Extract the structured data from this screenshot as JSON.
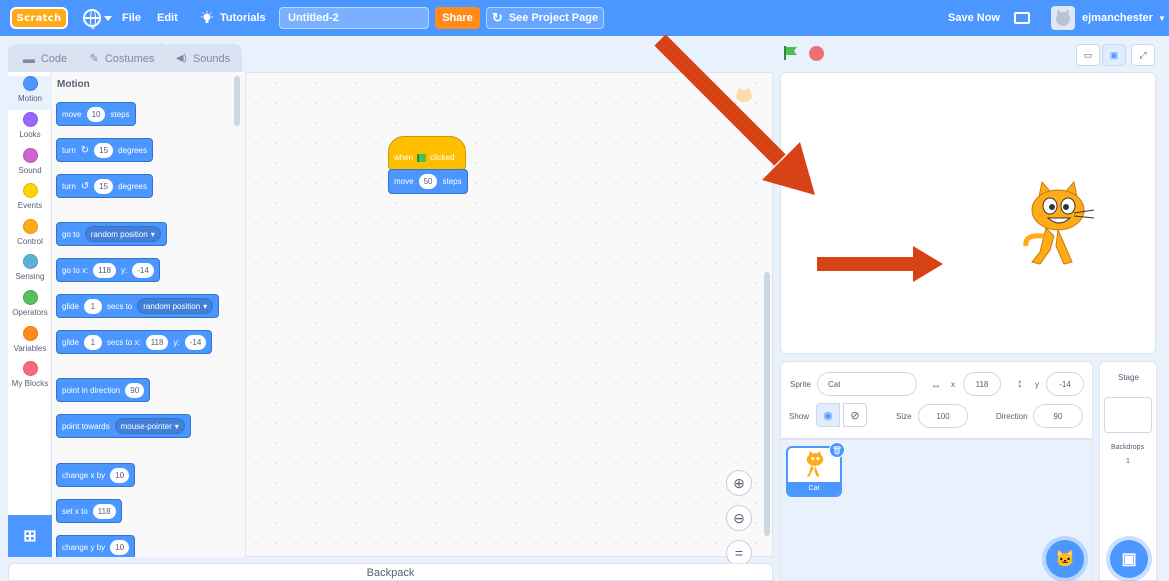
{
  "menubar": {
    "logo": "Scratch",
    "file": "File",
    "edit": "Edit",
    "tutorials": "Tutorials",
    "project_title": "Untitled-2",
    "share": "Share",
    "see_project_page": "See Project Page",
    "save_now": "Save Now",
    "username": "ejmanchester"
  },
  "tabs": [
    {
      "label": "Code",
      "icon": "code-icon"
    },
    {
      "label": "Costumes",
      "icon": "brush-icon"
    },
    {
      "label": "Sounds",
      "icon": "speaker-icon"
    }
  ],
  "categories": [
    {
      "label": "Motion",
      "color": "#4c97ff"
    },
    {
      "label": "Looks",
      "color": "#9966ff"
    },
    {
      "label": "Sound",
      "color": "#cf63cf"
    },
    {
      "label": "Events",
      "color": "#ffd500"
    },
    {
      "label": "Control",
      "color": "#ffab19"
    },
    {
      "label": "Sensing",
      "color": "#5cb1d6"
    },
    {
      "label": "Operators",
      "color": "#59c059"
    },
    {
      "label": "Variables",
      "color": "#ff8c1a"
    },
    {
      "label": "My Blocks",
      "color": "#ff6680"
    }
  ],
  "palette": {
    "title": "Motion",
    "move": {
      "a": "move",
      "v": "10",
      "b": "steps"
    },
    "turn_cw": {
      "a": "turn",
      "v": "15",
      "b": "degrees"
    },
    "turn_ccw": {
      "a": "turn",
      "v": "15",
      "b": "degrees"
    },
    "goto": {
      "a": "go to",
      "d": "random position"
    },
    "goto_xy": {
      "a": "go to x:",
      "x": "118",
      "b": "y:",
      "y": "-14"
    },
    "glide": {
      "a": "glide",
      "v": "1",
      "b": "secs to",
      "d": "random position"
    },
    "glide_xy": {
      "a": "glide",
      "v": "1",
      "b": "secs to x:",
      "x": "118",
      "c": "y:",
      "y": "-14"
    },
    "point_dir": {
      "a": "point in direction",
      "v": "90"
    },
    "point_towards": {
      "a": "point towards",
      "d": "mouse-pointer"
    },
    "change_x": {
      "a": "change x by",
      "v": "10"
    },
    "set_x": {
      "a": "set x to",
      "v": "118"
    },
    "change_y": {
      "a": "change y by",
      "v": "10"
    }
  },
  "script": {
    "hat_a": "when",
    "hat_b": "clicked",
    "move_a": "move",
    "move_v": "50",
    "move_b": "steps"
  },
  "backpack": "Backpack",
  "sprite_info": {
    "sprite_label": "Sprite",
    "sprite_name": "Cat",
    "x_label": "x",
    "x": "118",
    "y_label": "y",
    "y": "-14",
    "show_label": "Show",
    "size_label": "Size",
    "size": "100",
    "direction_label": "Direction",
    "direction": "90"
  },
  "sprites": [
    {
      "name": "Cat"
    }
  ],
  "stage_panel": {
    "title": "Stage",
    "backdrops_label": "Backdrops",
    "backdrops_count": "1"
  },
  "colors": {
    "accent": "#4c97ff",
    "share": "#ff8c1a",
    "events": "#ffbf00",
    "arrow": "#d84315"
  }
}
